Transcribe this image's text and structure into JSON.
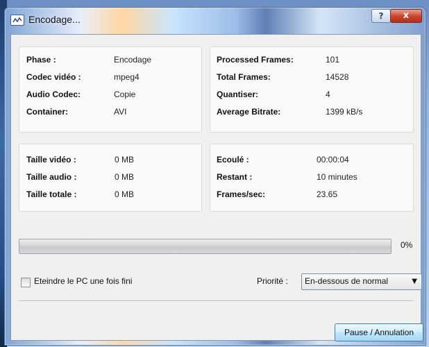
{
  "window": {
    "title": "Encodage...",
    "help_label": "?",
    "close_label": "x"
  },
  "info_panel": {
    "rows": [
      {
        "label": "Phase :",
        "value": "Encodage"
      },
      {
        "label": "Codec vidéo :",
        "value": "mpeg4"
      },
      {
        "label": "Audio Codec:",
        "value": "Copie"
      },
      {
        "label": "Container:",
        "value": "AVI"
      }
    ]
  },
  "stats_panel": {
    "rows": [
      {
        "label": "Processed Frames:",
        "value": "101"
      },
      {
        "label": "Total Frames:",
        "value": "14528"
      },
      {
        "label": "Quantiser:",
        "value": "4"
      },
      {
        "label": "Average Bitrate:",
        "value": "1399 kB/s"
      }
    ]
  },
  "size_panel": {
    "rows": [
      {
        "label": "Taille vidéo :",
        "value": "0 MB"
      },
      {
        "label": "Taille audio :",
        "value": "0 MB"
      },
      {
        "label": "Taille totale :",
        "value": "0 MB"
      }
    ]
  },
  "time_panel": {
    "rows": [
      {
        "label": "Ecoulé :",
        "value": "00:00:04"
      },
      {
        "label": "Restant :",
        "value": "10 minutes"
      },
      {
        "label": "Frames/sec:",
        "value": "23.65"
      }
    ]
  },
  "progress": {
    "fraction": 0.0,
    "percent_label": "0%"
  },
  "shutdown_checkbox": {
    "label": "Eteindre le PC une fois fini",
    "checked": false
  },
  "priority": {
    "label": "Priorité :",
    "selected": "En-dessous de normal"
  },
  "actions": {
    "pause_label": "Pause / Annulation"
  },
  "colors": {
    "progress_fill": "#37c24a",
    "accent": "#3c7fb1"
  }
}
